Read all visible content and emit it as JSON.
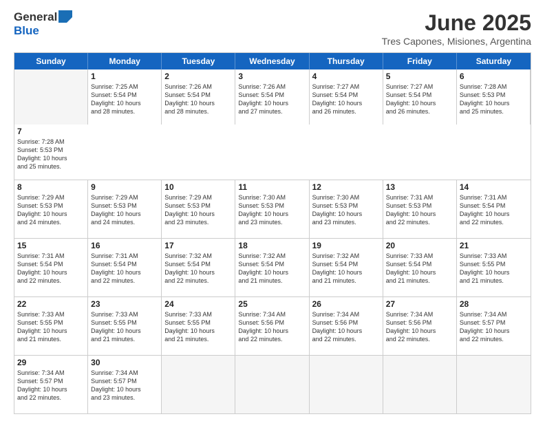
{
  "logo": {
    "general": "General",
    "blue": "Blue"
  },
  "title": "June 2025",
  "location": "Tres Capones, Misiones, Argentina",
  "weekdays": [
    "Sunday",
    "Monday",
    "Tuesday",
    "Wednesday",
    "Thursday",
    "Friday",
    "Saturday"
  ],
  "rows": [
    [
      {
        "day": "",
        "empty": true
      },
      {
        "day": "1",
        "info": "Sunrise: 7:25 AM\nSunset: 5:54 PM\nDaylight: 10 hours\nand 28 minutes."
      },
      {
        "day": "2",
        "info": "Sunrise: 7:26 AM\nSunset: 5:54 PM\nDaylight: 10 hours\nand 28 minutes."
      },
      {
        "day": "3",
        "info": "Sunrise: 7:26 AM\nSunset: 5:54 PM\nDaylight: 10 hours\nand 27 minutes."
      },
      {
        "day": "4",
        "info": "Sunrise: 7:27 AM\nSunset: 5:54 PM\nDaylight: 10 hours\nand 26 minutes."
      },
      {
        "day": "5",
        "info": "Sunrise: 7:27 AM\nSunset: 5:54 PM\nDaylight: 10 hours\nand 26 minutes."
      },
      {
        "day": "6",
        "info": "Sunrise: 7:28 AM\nSunset: 5:53 PM\nDaylight: 10 hours\nand 25 minutes."
      },
      {
        "day": "7",
        "info": "Sunrise: 7:28 AM\nSunset: 5:53 PM\nDaylight: 10 hours\nand 25 minutes."
      }
    ],
    [
      {
        "day": "8",
        "info": "Sunrise: 7:29 AM\nSunset: 5:53 PM\nDaylight: 10 hours\nand 24 minutes."
      },
      {
        "day": "9",
        "info": "Sunrise: 7:29 AM\nSunset: 5:53 PM\nDaylight: 10 hours\nand 24 minutes."
      },
      {
        "day": "10",
        "info": "Sunrise: 7:29 AM\nSunset: 5:53 PM\nDaylight: 10 hours\nand 23 minutes."
      },
      {
        "day": "11",
        "info": "Sunrise: 7:30 AM\nSunset: 5:53 PM\nDaylight: 10 hours\nand 23 minutes."
      },
      {
        "day": "12",
        "info": "Sunrise: 7:30 AM\nSunset: 5:53 PM\nDaylight: 10 hours\nand 23 minutes."
      },
      {
        "day": "13",
        "info": "Sunrise: 7:31 AM\nSunset: 5:53 PM\nDaylight: 10 hours\nand 22 minutes."
      },
      {
        "day": "14",
        "info": "Sunrise: 7:31 AM\nSunset: 5:54 PM\nDaylight: 10 hours\nand 22 minutes."
      }
    ],
    [
      {
        "day": "15",
        "info": "Sunrise: 7:31 AM\nSunset: 5:54 PM\nDaylight: 10 hours\nand 22 minutes."
      },
      {
        "day": "16",
        "info": "Sunrise: 7:31 AM\nSunset: 5:54 PM\nDaylight: 10 hours\nand 22 minutes."
      },
      {
        "day": "17",
        "info": "Sunrise: 7:32 AM\nSunset: 5:54 PM\nDaylight: 10 hours\nand 22 minutes."
      },
      {
        "day": "18",
        "info": "Sunrise: 7:32 AM\nSunset: 5:54 PM\nDaylight: 10 hours\nand 21 minutes."
      },
      {
        "day": "19",
        "info": "Sunrise: 7:32 AM\nSunset: 5:54 PM\nDaylight: 10 hours\nand 21 minutes."
      },
      {
        "day": "20",
        "info": "Sunrise: 7:33 AM\nSunset: 5:54 PM\nDaylight: 10 hours\nand 21 minutes."
      },
      {
        "day": "21",
        "info": "Sunrise: 7:33 AM\nSunset: 5:55 PM\nDaylight: 10 hours\nand 21 minutes."
      }
    ],
    [
      {
        "day": "22",
        "info": "Sunrise: 7:33 AM\nSunset: 5:55 PM\nDaylight: 10 hours\nand 21 minutes."
      },
      {
        "day": "23",
        "info": "Sunrise: 7:33 AM\nSunset: 5:55 PM\nDaylight: 10 hours\nand 21 minutes."
      },
      {
        "day": "24",
        "info": "Sunrise: 7:33 AM\nSunset: 5:55 PM\nDaylight: 10 hours\nand 21 minutes."
      },
      {
        "day": "25",
        "info": "Sunrise: 7:34 AM\nSunset: 5:56 PM\nDaylight: 10 hours\nand 22 minutes."
      },
      {
        "day": "26",
        "info": "Sunrise: 7:34 AM\nSunset: 5:56 PM\nDaylight: 10 hours\nand 22 minutes."
      },
      {
        "day": "27",
        "info": "Sunrise: 7:34 AM\nSunset: 5:56 PM\nDaylight: 10 hours\nand 22 minutes."
      },
      {
        "day": "28",
        "info": "Sunrise: 7:34 AM\nSunset: 5:57 PM\nDaylight: 10 hours\nand 22 minutes."
      }
    ],
    [
      {
        "day": "29",
        "info": "Sunrise: 7:34 AM\nSunset: 5:57 PM\nDaylight: 10 hours\nand 22 minutes."
      },
      {
        "day": "30",
        "info": "Sunrise: 7:34 AM\nSunset: 5:57 PM\nDaylight: 10 hours\nand 23 minutes."
      },
      {
        "day": "",
        "empty": true
      },
      {
        "day": "",
        "empty": true
      },
      {
        "day": "",
        "empty": true
      },
      {
        "day": "",
        "empty": true
      },
      {
        "day": "",
        "empty": true
      }
    ]
  ]
}
